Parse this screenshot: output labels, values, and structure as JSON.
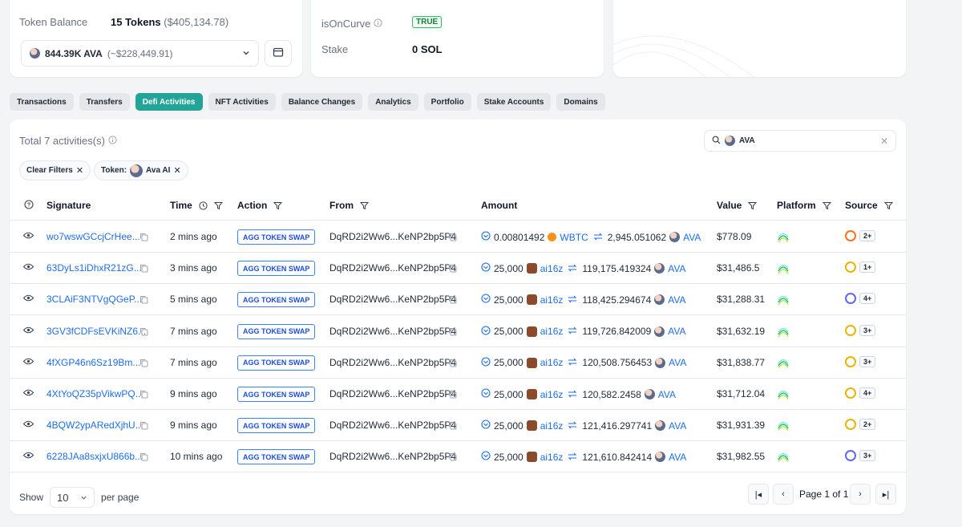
{
  "overview": {
    "token_balance_label": "Token Balance",
    "token_count": "15 Tokens",
    "token_usd": "($405,134.78)",
    "selected_token_amount": "844.39K AVA",
    "selected_token_usd": "(~$228,449.91)",
    "is_on_curve_label": "isOnCurve",
    "is_on_curve_value": "TRUE",
    "stake_label": "Stake",
    "stake_value": "0 SOL"
  },
  "tabs": [
    {
      "label": "Transactions",
      "active": false
    },
    {
      "label": "Transfers",
      "active": false
    },
    {
      "label": "Defi Activities",
      "active": true
    },
    {
      "label": "NFT Activities",
      "active": false
    },
    {
      "label": "Balance Changes",
      "active": false
    },
    {
      "label": "Analytics",
      "active": false
    },
    {
      "label": "Portfolio",
      "active": false
    },
    {
      "label": "Stake Accounts",
      "active": false
    },
    {
      "label": "Domains",
      "active": false
    }
  ],
  "activities": {
    "total_text": "Total 7 activities(s)",
    "search_value": "AVA",
    "clear_filters_label": "Clear Filters",
    "token_filter_prefix": "Token:",
    "token_filter_value": "Ava AI",
    "columns": {
      "signature": "Signature",
      "time": "Time",
      "action": "Action",
      "from": "From",
      "amount": "Amount",
      "value": "Value",
      "platform": "Platform",
      "source": "Source"
    },
    "rows": [
      {
        "signature": "wo7wswGCcjCrHee...",
        "time": "2 mins ago",
        "action": "AGG TOKEN SWAP",
        "from": "DqRD2i2Ww6...KeNP2bp5P4",
        "in_amount": "0.00801492",
        "in_token": "WBTC",
        "out_amount": "2,945.051062",
        "out_token": "AVA",
        "value": "$778.09",
        "source_count": "2+",
        "source_color": "#f97316"
      },
      {
        "signature": "63DyLs1iDhxR21zG...",
        "time": "3 mins ago",
        "action": "AGG TOKEN SWAP",
        "from": "DqRD2i2Ww6...KeNP2bp5P4",
        "in_amount": "25,000",
        "in_token": "ai16z",
        "out_amount": "119,175.419324",
        "out_token": "AVA",
        "value": "$31,486.5",
        "source_count": "1+",
        "source_color": "#eab308"
      },
      {
        "signature": "3CLAiF3NTVgQGeP...",
        "time": "5 mins ago",
        "action": "AGG TOKEN SWAP",
        "from": "DqRD2i2Ww6...KeNP2bp5P4",
        "in_amount": "25,000",
        "in_token": "ai16z",
        "out_amount": "118,425.294674",
        "out_token": "AVA",
        "value": "$31,288.31",
        "source_count": "4+",
        "source_color": "#6366f1"
      },
      {
        "signature": "3GV3fCDFsEVKiNZ6...",
        "time": "7 mins ago",
        "action": "AGG TOKEN SWAP",
        "from": "DqRD2i2Ww6...KeNP2bp5P4",
        "in_amount": "25,000",
        "in_token": "ai16z",
        "out_amount": "119,726.842009",
        "out_token": "AVA",
        "value": "$31,632.19",
        "source_count": "3+",
        "source_color": "#eab308"
      },
      {
        "signature": "4fXGP46n6Sz19Bm...",
        "time": "7 mins ago",
        "action": "AGG TOKEN SWAP",
        "from": "DqRD2i2Ww6...KeNP2bp5P4",
        "in_amount": "25,000",
        "in_token": "ai16z",
        "out_amount": "120,508.756453",
        "out_token": "AVA",
        "value": "$31,838.77",
        "source_count": "3+",
        "source_color": "#eab308"
      },
      {
        "signature": "4XtYoQZ35pVikwPQ...",
        "time": "9 mins ago",
        "action": "AGG TOKEN SWAP",
        "from": "DqRD2i2Ww6...KeNP2bp5P4",
        "in_amount": "25,000",
        "in_token": "ai16z",
        "out_amount": "120,582.2458",
        "out_token": "AVA",
        "value": "$31,712.04",
        "source_count": "4+",
        "source_color": "#eab308"
      },
      {
        "signature": "4BQW2ypARedXjhU...",
        "time": "9 mins ago",
        "action": "AGG TOKEN SWAP",
        "from": "DqRD2i2Ww6...KeNP2bp5P4",
        "in_amount": "25,000",
        "in_token": "ai16z",
        "out_amount": "121,416.297741",
        "out_token": "AVA",
        "value": "$31,931.39",
        "source_count": "2+",
        "source_color": "#eab308"
      },
      {
        "signature": "6228JAa8sxjxU866b...",
        "time": "10 mins ago",
        "action": "AGG TOKEN SWAP",
        "from": "DqRD2i2Ww6...KeNP2bp5P4",
        "in_amount": "25,000",
        "in_token": "ai16z",
        "out_amount": "121,610.842414",
        "out_token": "AVA",
        "value": "$31,982.55",
        "source_count": "3+",
        "source_color": "#6366f1"
      }
    ],
    "footer": {
      "show_label": "Show",
      "page_size": "10",
      "per_page_label": "per page",
      "page_text": "Page 1 of 1"
    }
  },
  "colors": {
    "accent": "#22a597",
    "link": "#1d6ee8",
    "true_green": "#15803d"
  }
}
